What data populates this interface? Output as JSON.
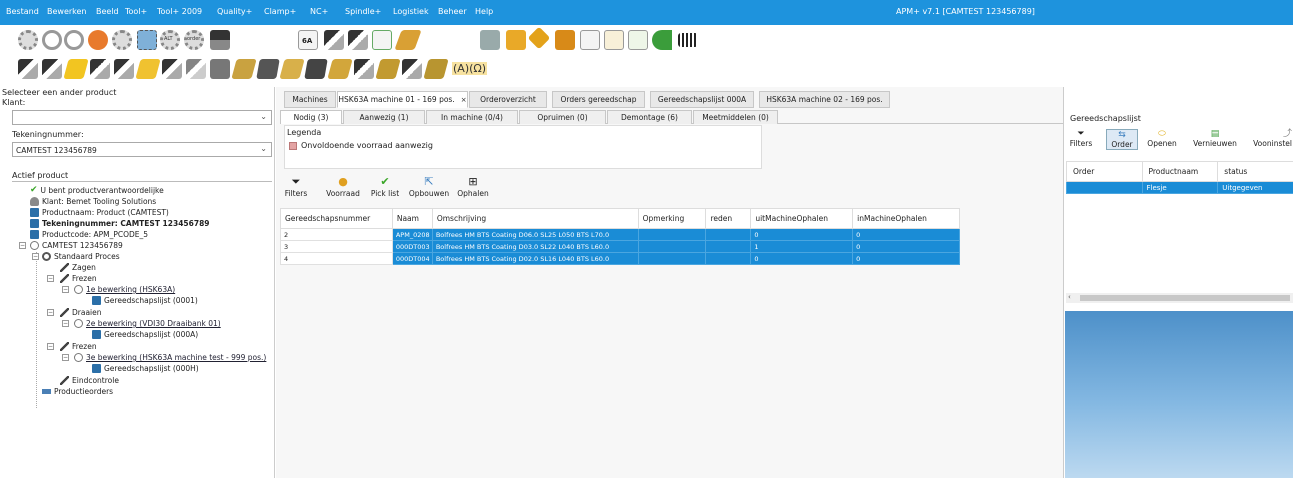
{
  "menu": {
    "items": [
      "Bestand",
      "Bewerken",
      "Beeld",
      "Tool+",
      "Tool+ 2009",
      "Quality+",
      "Clamp+",
      "NC+",
      "Spindle+",
      "Logistiek",
      "Beheer",
      "Help"
    ],
    "window_title": "APM+ v7.1 [CAMTEST 123456789]"
  },
  "toolbar": {
    "label_6a": "6A",
    "label_alt": "ALT",
    "label_order": "order",
    "label_omega": "(A)(Ω)"
  },
  "left": {
    "header": "Selecteer een ander product",
    "klant_label": "Klant:",
    "klant_value": "",
    "tekening_label": "Tekeningnummer:",
    "tekening_value": "CAMTEST 123456789",
    "actief_label": "Actief product",
    "tree": [
      "U bent productverantwoordelijke",
      "Klant: Bemet Tooling Solutions",
      "Productnaam: Product (CAMTEST)",
      "Tekeningnummer: CAMTEST 123456789",
      "Productcode: APM_PCODE_5",
      "CAMTEST 123456789",
      "Standaard Proces",
      "Zagen",
      "Frezen",
      "1e bewerking (HSK63A)",
      "Gereedschapslijst (0001)",
      "Draaien",
      "2e bewerking (VDI30 Draaibank 01)",
      "Gereedschapslijst (000A)",
      "Frezen",
      "3e bewerking (HSK63A machine test - 999 pos.)",
      "Gereedschapslijst (000H)",
      "Eindcontrole",
      "Productieorders"
    ]
  },
  "center": {
    "tabs": [
      "Machines",
      "HSK63A machine 01 - 169 pos.",
      "Orderoverzicht",
      "Orders gereedschap",
      "Gereedschapslijst 000A",
      "HSK63A machine 02 - 169 pos."
    ],
    "tab_close": "×",
    "subtabs": [
      "Nodig (3)",
      "Aanwezig (1)",
      "In machine (0/4)",
      "Opruimen (0)",
      "Demontage (6)",
      "Meetmiddelen (0)"
    ],
    "legend_title": "Legenda",
    "legend_item": "Onvoldoende voorraad aanwezig",
    "actions": [
      "Filters",
      "Voorraad",
      "Pick list",
      "Opbouwen",
      "Ophalen"
    ],
    "columns": [
      "Gereedschapsnummer",
      "Naam",
      "Omschrijving",
      "Opmerking",
      "reden",
      "uitMachineOphalen",
      "inMachineOphalen"
    ],
    "rows": [
      [
        "2",
        "APM_0208",
        "Bolfrees HM BTS Coating D06.0 SL25 L050 BTS L70.0",
        "",
        "",
        "0",
        "0"
      ],
      [
        "3",
        "000DT003",
        "Bolfrees HM BTS Coating D03.0 SL22 L040 BTS L60.0",
        "",
        "",
        "1",
        "0"
      ],
      [
        "4",
        "000DT004",
        "Bolfrees HM BTS Coating D02.0 SL16 L040 BTS L60.0",
        "",
        "",
        "0",
        "0"
      ]
    ]
  },
  "right": {
    "title": "Gereedschapslijst",
    "buttons": [
      "Filters",
      "Order",
      "Openen",
      "Vernieuwen",
      "Vooninstel"
    ],
    "columns": [
      "Order",
      "Productnaam",
      "status"
    ],
    "rows": [
      [
        "",
        "Flesje",
        "Uitgegeven"
      ]
    ]
  }
}
